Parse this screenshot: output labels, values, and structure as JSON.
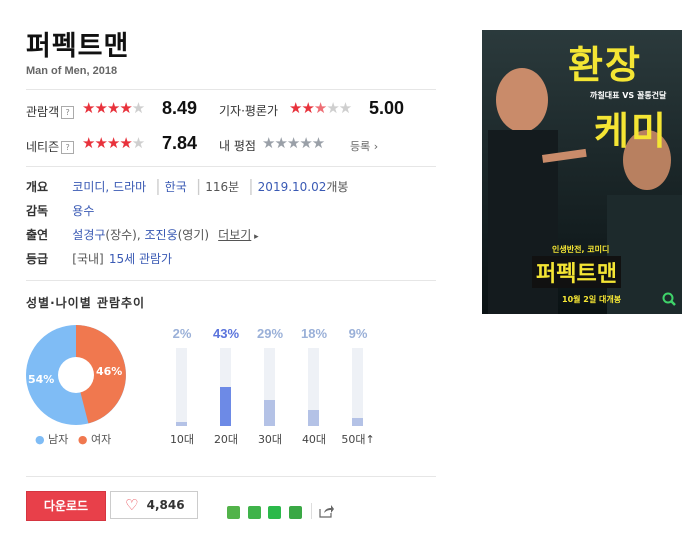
{
  "movie": {
    "title": "퍼펙트맨",
    "subtitle": "Man of Men, 2018"
  },
  "ratings": {
    "audience": {
      "label": "관람객",
      "score": "8.49",
      "stars": 4.25
    },
    "critics": {
      "label": "기자·평론가",
      "score": "5.00",
      "stars": 2.5
    },
    "netizen": {
      "label": "네티즌",
      "score": "7.84",
      "stars": 4
    },
    "mine": {
      "label": "내 평점",
      "action": "등록"
    }
  },
  "info": {
    "overview_label": "개요",
    "genre1": "코미디",
    "genre2": "드라마",
    "country": "한국",
    "runtime": "116분",
    "release_date": "2019.10.02",
    "release_suffix": "개봉",
    "director_label": "감독",
    "director": "용수",
    "cast_label": "출연",
    "cast1": "설경구",
    "cast1_role": "(장수)",
    "cast2": "조진웅",
    "cast2_role": "(영기)",
    "more": "더보기",
    "grade_label": "등급",
    "grade_region": "[국내]",
    "grade_value": "15세 관람가"
  },
  "trend": {
    "title": "성별·나이별 관람추이",
    "male_pct": "54%",
    "female_pct": "46%",
    "male_label": "남자",
    "female_label": "여자",
    "ages": [
      {
        "label": "10대",
        "pct": "2%",
        "value": 2
      },
      {
        "label": "20대",
        "pct": "43%",
        "value": 43
      },
      {
        "label": "30대",
        "pct": "29%",
        "value": 29
      },
      {
        "label": "40대",
        "pct": "18%",
        "value": 18
      },
      {
        "label": "50대↑",
        "pct": "9%",
        "value": 9
      }
    ]
  },
  "actions": {
    "download": "다운로드",
    "likes": "4,846"
  },
  "poster": {
    "headline1": "환장",
    "headline2": "케미",
    "tagline": "까칠대표 VS 꼴통건달",
    "kicker": "인생반전, 코미디",
    "title": "퍼펙트맨",
    "release": "10월 2일 대개봉"
  },
  "colors": {
    "accent_red": "#e8404a",
    "male": "#7fbcf5",
    "female": "#f0784f",
    "link": "#3a5ab4"
  }
}
